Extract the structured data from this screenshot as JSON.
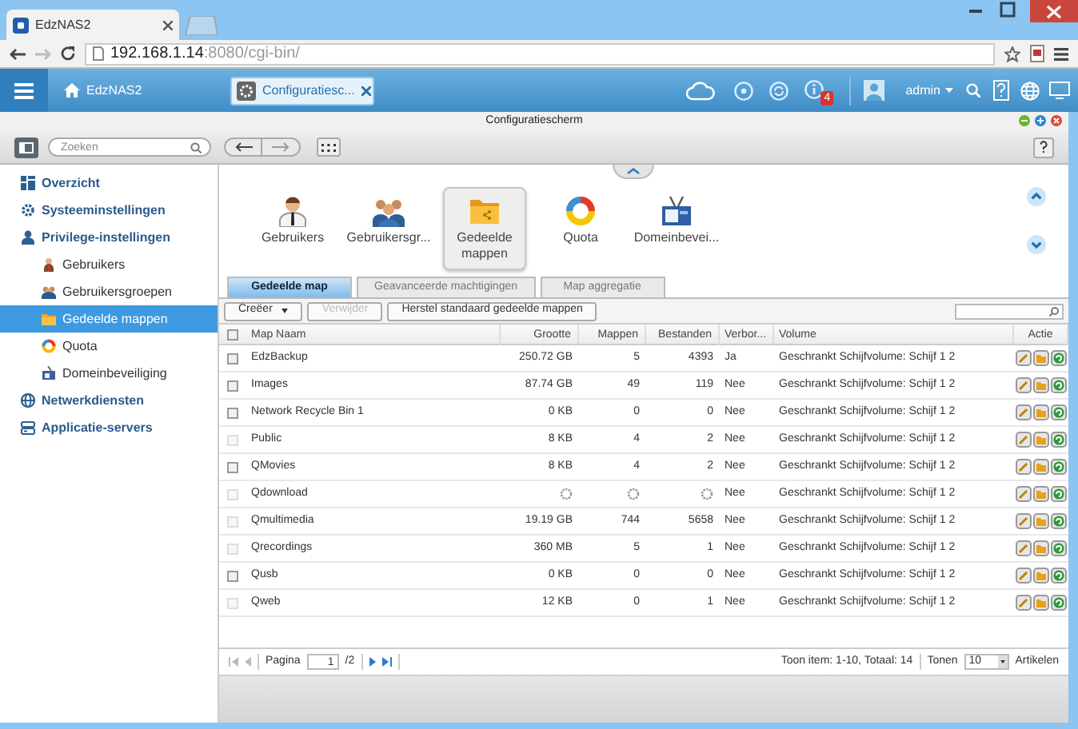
{
  "browser": {
    "tab_title": "EdzNAS2",
    "url_host": "192.168.1.14",
    "url_rest": ":8080/cgi-bin/"
  },
  "app_bar": {
    "home_label": "EdzNAS2",
    "tab_label": "Configuratiesc...",
    "notification_count": "4",
    "user": "admin"
  },
  "window": {
    "title": "Configuratiescherm"
  },
  "search": {
    "placeholder": "Zoeken"
  },
  "sidebar": {
    "items": [
      {
        "label": "Overzicht",
        "selected": false
      },
      {
        "label": "Systeeminstellingen",
        "selected": false
      },
      {
        "label": "Privilege-instellingen",
        "selected": false,
        "children": [
          {
            "label": "Gebruikers",
            "selected": false
          },
          {
            "label": "Gebruikersgroepen",
            "selected": false
          },
          {
            "label": "Gedeelde mappen",
            "selected": true
          },
          {
            "label": "Quota",
            "selected": false
          },
          {
            "label": "Domeinbeveiliging",
            "selected": false
          }
        ]
      },
      {
        "label": "Netwerkdiensten",
        "selected": false
      },
      {
        "label": "Applicatie-servers",
        "selected": false
      }
    ]
  },
  "launcher": {
    "items": [
      {
        "label": "Gebruikers",
        "selected": false
      },
      {
        "label": "Gebruikersgr...",
        "selected": false
      },
      {
        "label": "Gedeelde mappen",
        "selected": true
      },
      {
        "label": "Quota",
        "selected": false
      },
      {
        "label": "Domeinbevei...",
        "selected": false
      }
    ]
  },
  "tabs": [
    {
      "label": "Gedeelde map",
      "selected": true
    },
    {
      "label": "Geavanceerde machtigingen",
      "selected": false
    },
    {
      "label": "Map aggregatie",
      "selected": false
    }
  ],
  "toolbar": {
    "buttons": [
      {
        "label": "Creëer",
        "kind": "dropdown",
        "disabled": false
      },
      {
        "label": "Verwijder",
        "kind": "plain",
        "disabled": true
      },
      {
        "label": "Herstel standaard gedeelde mappen",
        "kind": "plain",
        "disabled": false
      }
    ]
  },
  "table": {
    "all_checked": false,
    "columns": [
      "Map Naam",
      "Grootte",
      "Mappen",
      "Bestanden",
      "Verbor...",
      "Volume",
      "Actie"
    ],
    "rows": [
      {
        "selectable": true,
        "loading": false,
        "name": "EdzBackup",
        "size": "250.72 GB",
        "folders": "5",
        "files": "4393",
        "hidden": "Ja",
        "volume": "Geschrankt Schijfvolume: Schijf 1 2"
      },
      {
        "selectable": true,
        "loading": false,
        "name": "Images",
        "size": "87.74 GB",
        "folders": "49",
        "files": "119",
        "hidden": "Nee",
        "volume": "Geschrankt Schijfvolume: Schijf 1 2"
      },
      {
        "selectable": true,
        "loading": false,
        "name": "Network Recycle Bin 1",
        "size": "0 KB",
        "folders": "0",
        "files": "0",
        "hidden": "Nee",
        "volume": "Geschrankt Schijfvolume: Schijf 1 2"
      },
      {
        "selectable": false,
        "loading": false,
        "name": "Public",
        "size": "8 KB",
        "folders": "4",
        "files": "2",
        "hidden": "Nee",
        "volume": "Geschrankt Schijfvolume: Schijf 1 2"
      },
      {
        "selectable": true,
        "loading": false,
        "name": "QMovies",
        "size": "8 KB",
        "folders": "4",
        "files": "2",
        "hidden": "Nee",
        "volume": "Geschrankt Schijfvolume: Schijf 1 2"
      },
      {
        "selectable": false,
        "loading": true,
        "name": "Qdownload",
        "hidden": "Nee",
        "volume": "Geschrankt Schijfvolume: Schijf 1 2"
      },
      {
        "selectable": false,
        "loading": false,
        "name": "Qmultimedia",
        "size": "19.19 GB",
        "folders": "744",
        "files": "5658",
        "hidden": "Nee",
        "volume": "Geschrankt Schijfvolume: Schijf 1 2"
      },
      {
        "selectable": false,
        "loading": false,
        "name": "Qrecordings",
        "size": "360 MB",
        "folders": "5",
        "files": "1",
        "hidden": "Nee",
        "volume": "Geschrankt Schijfvolume: Schijf 1 2"
      },
      {
        "selectable": true,
        "loading": false,
        "name": "Qusb",
        "size": "0 KB",
        "folders": "0",
        "files": "0",
        "hidden": "Nee",
        "volume": "Geschrankt Schijfvolume: Schijf 1 2"
      },
      {
        "selectable": false,
        "loading": false,
        "name": "Qweb",
        "size": "12 KB",
        "folders": "0",
        "files": "1",
        "hidden": "Nee",
        "volume": "Geschrankt Schijfvolume: Schijf 1 2"
      }
    ]
  },
  "pager": {
    "page_label": "Pagina",
    "page": "1",
    "of": "/2",
    "summary": "Toon item: 1-10, Totaal: 14",
    "show_label": "Tonen",
    "per_page": "10",
    "items_label": "Artikelen"
  }
}
